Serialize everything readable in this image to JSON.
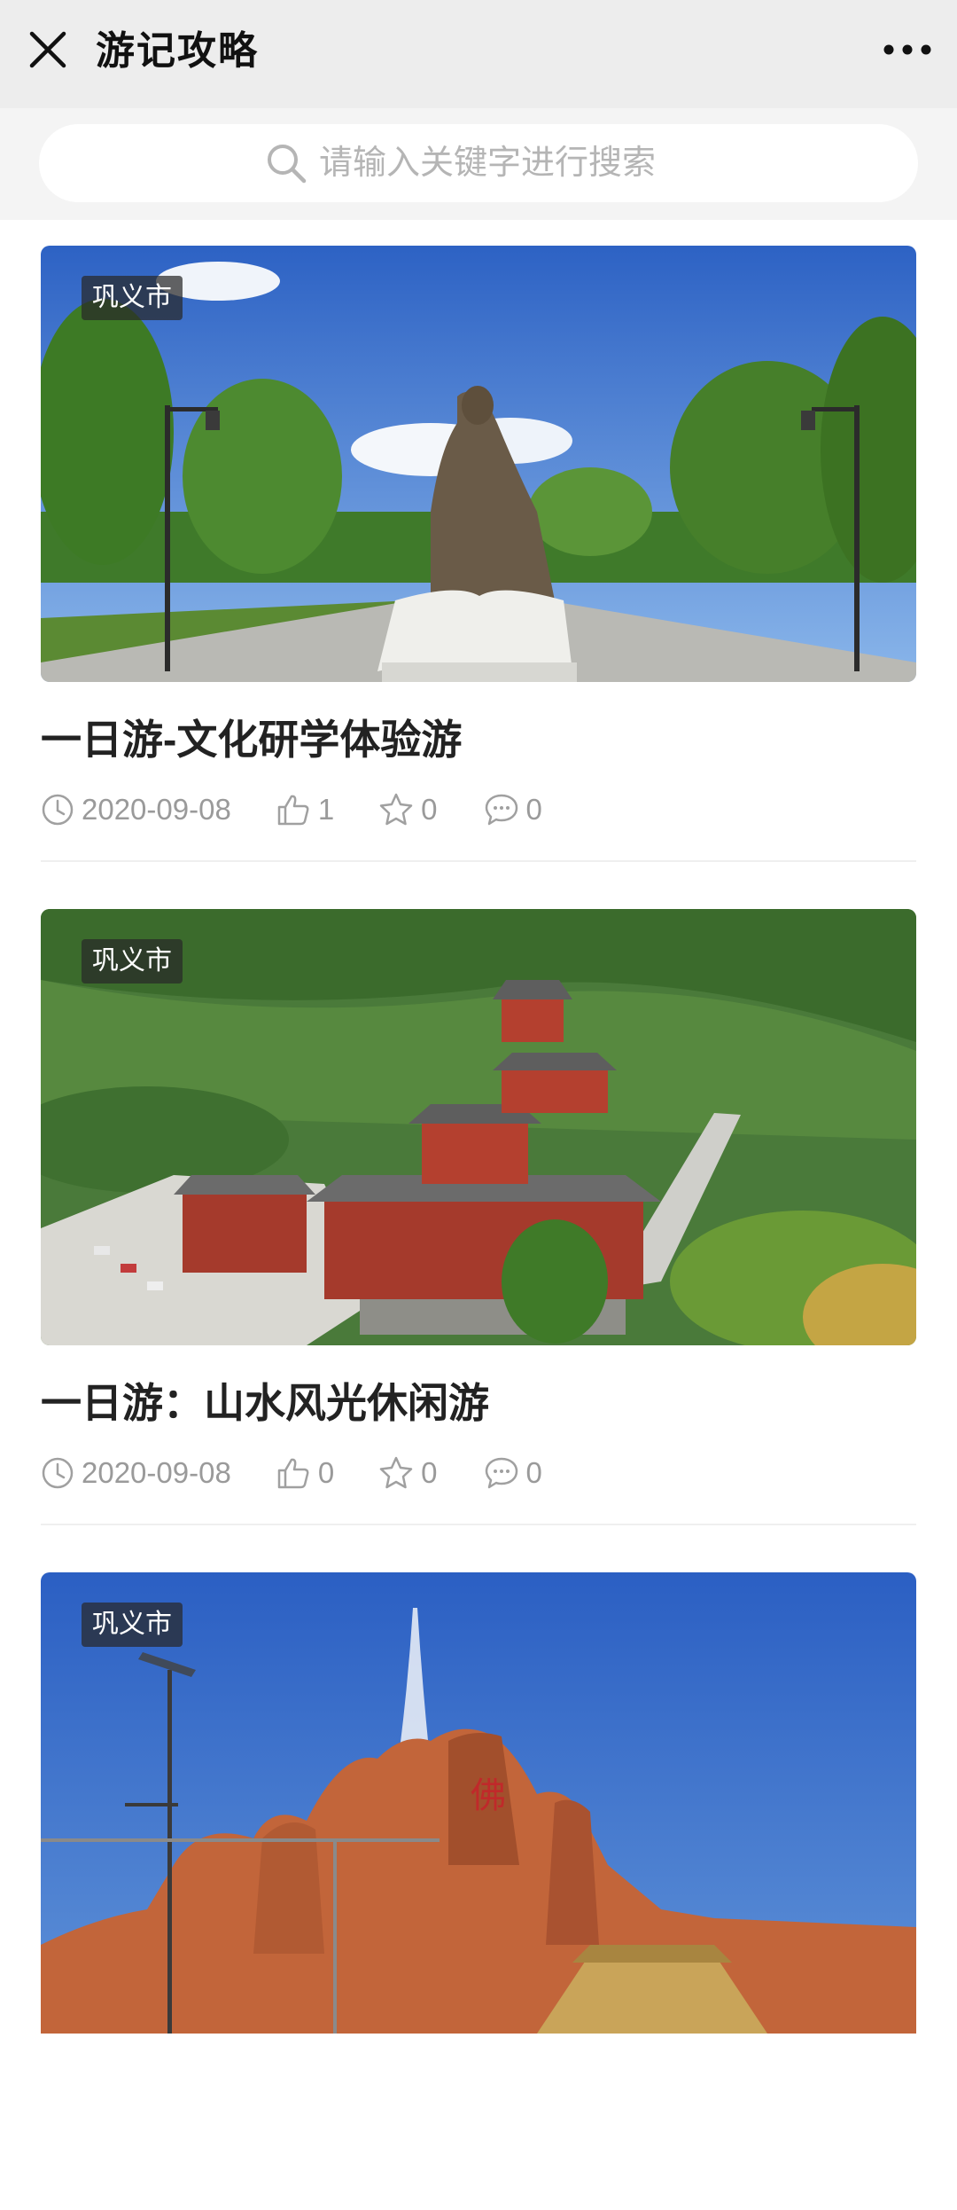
{
  "header": {
    "title": "游记攻略",
    "close_icon": "close-icon",
    "more_icon": "more-dots-icon"
  },
  "search": {
    "placeholder": "请输入关键字进行搜索",
    "icon": "search-icon"
  },
  "articles": [
    {
      "tag": "巩义市",
      "title": "一日游-文化研学体验游",
      "date": "2020-09-08",
      "likes": "1",
      "favorites": "0",
      "comments": "0",
      "image": "statue-with-book-park-photo"
    },
    {
      "tag": "巩义市",
      "title": "一日游：山水风光休闲游",
      "date": "2020-09-08",
      "likes": "0",
      "favorites": "0",
      "comments": "0",
      "image": "mountain-temple-complex-photo"
    },
    {
      "tag": "巩义市",
      "title": "",
      "date": "",
      "likes": "",
      "favorites": "",
      "comments": "",
      "image": "rock-fountain-photo"
    }
  ],
  "colors": {
    "header_bg": "#ededed",
    "search_bg": "#f4f4f4",
    "meta_text": "#9a9a9a",
    "title_text": "#222222"
  }
}
